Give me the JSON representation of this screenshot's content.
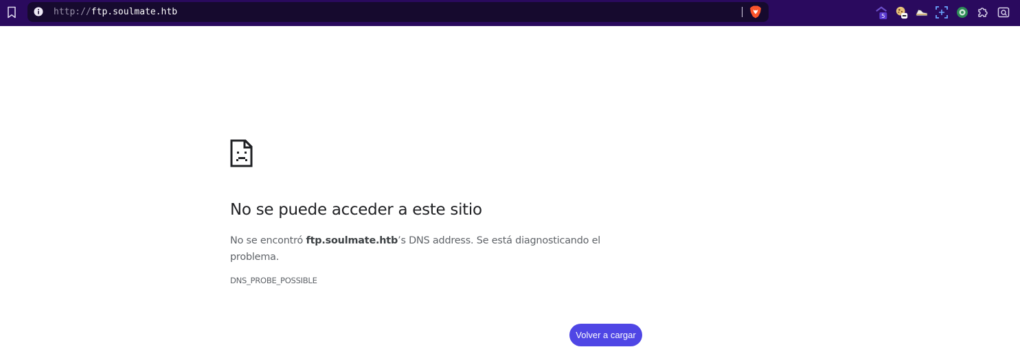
{
  "browser": {
    "address_bar": {
      "scheme": "http://",
      "host": "ftp.soulmate.htb"
    },
    "toolbar_icons": [
      "bookmark-icon",
      "site-info-icon",
      "brave-shields-icon"
    ],
    "extensions": [
      {
        "name": "extension-badge-icon",
        "badge": "5"
      },
      {
        "name": "cookie-extension-icon"
      },
      {
        "name": "sneaker-extension-icon"
      },
      {
        "name": "scan-extension-icon"
      },
      {
        "name": "green-circle-extension-icon"
      },
      {
        "name": "puzzle-extensions-icon"
      },
      {
        "name": "screenshot-extension-icon"
      }
    ],
    "colors": {
      "toolbar": "#2a0a5e",
      "omnibox": "#160a2e",
      "accent": "#4f46e5"
    }
  },
  "error_page": {
    "icon": "sad-document-icon",
    "title": "No se puede acceder a este sitio",
    "message_prefix": "No se encontró ",
    "message_host": "ftp.soulmate.htb",
    "message_suffix": "’s DNS address. Se está diagnosticando el problema.",
    "error_code": "DNS_PROBE_POSSIBLE",
    "reload_button": "Volver a cargar"
  }
}
